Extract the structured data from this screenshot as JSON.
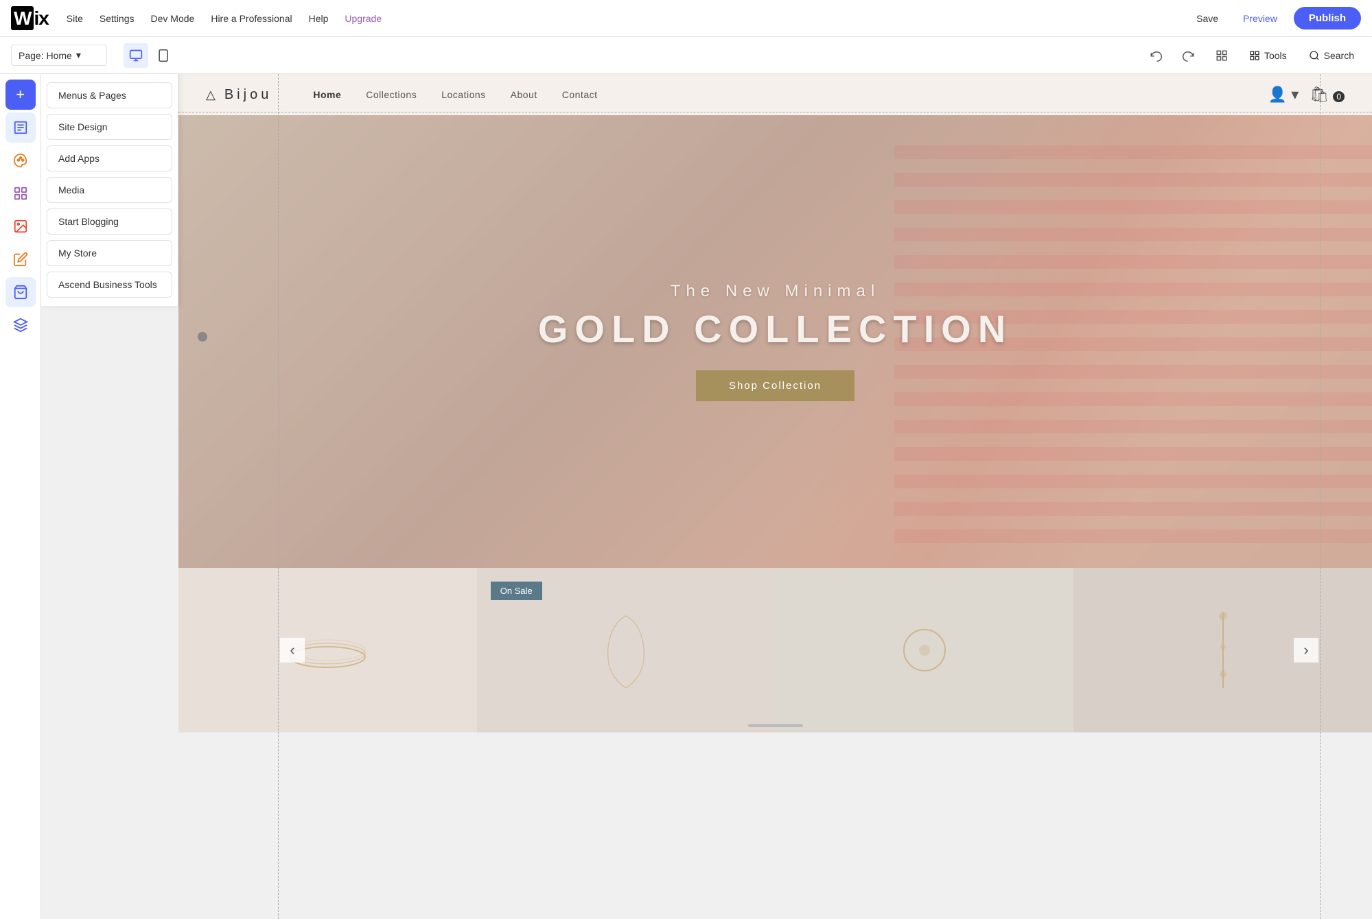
{
  "topbar": {
    "logo": "WiX",
    "nav": [
      {
        "label": "Site",
        "id": "site"
      },
      {
        "label": "Settings",
        "id": "settings"
      },
      {
        "label": "Dev Mode",
        "id": "dev-mode"
      },
      {
        "label": "Hire a Professional",
        "id": "hire"
      },
      {
        "label": "Help",
        "id": "help"
      },
      {
        "label": "Upgrade",
        "id": "upgrade",
        "class": "upgrade"
      }
    ],
    "save_label": "Save",
    "preview_label": "Preview",
    "publish_label": "Publish"
  },
  "secondbar": {
    "page_label": "Page: Home",
    "tools_label": "Tools",
    "search_label": "Search"
  },
  "sidebar": {
    "add_label": "+",
    "items": [
      {
        "id": "pages",
        "icon": "☰",
        "label": "Menus & Pages"
      },
      {
        "id": "design",
        "icon": "🎨",
        "label": "Site Design"
      },
      {
        "id": "apps",
        "icon": "⊞",
        "label": "Add Apps"
      },
      {
        "id": "media",
        "icon": "🖼",
        "label": "Media"
      },
      {
        "id": "blog",
        "icon": "✍",
        "label": "Start Blogging"
      },
      {
        "id": "store",
        "icon": "🛒",
        "label": "My Store"
      },
      {
        "id": "ascend",
        "icon": "⬆",
        "label": "Ascend Business Tools"
      }
    ]
  },
  "panel": {
    "buttons": [
      {
        "label": "Menus & Pages",
        "id": "menus-pages"
      },
      {
        "label": "Site Design",
        "id": "site-design"
      },
      {
        "label": "Add Apps",
        "id": "add-apps"
      },
      {
        "label": "Media",
        "id": "media"
      },
      {
        "label": "Start Blogging",
        "id": "start-blogging"
      },
      {
        "label": "My Store",
        "id": "my-store"
      },
      {
        "label": "Ascend Business Tools",
        "id": "ascend-tools"
      }
    ]
  },
  "site": {
    "logo_icon": "△",
    "logo_text": "Bijou",
    "nav": [
      {
        "label": "Home",
        "active": true
      },
      {
        "label": "Collections"
      },
      {
        "label": "Locations"
      },
      {
        "label": "About"
      },
      {
        "label": "Contact"
      }
    ],
    "hero": {
      "subtitle": "The New Minimal",
      "title": "GOLD COLLECTION",
      "cta": "Shop Collection"
    },
    "on_sale_label": "On Sale",
    "prev_arrow": "‹",
    "next_arrow": "›"
  },
  "colors": {
    "publish_bg": "#4b5ef5",
    "preview_color": "#4b5ef5",
    "upgrade_color": "#9b59b6",
    "hero_overlay": "rgba(180,160,150,0.35)",
    "shop_btn_bg": "rgba(160,140,80,0.85)",
    "on_sale_bg": "#5a7a8a"
  }
}
